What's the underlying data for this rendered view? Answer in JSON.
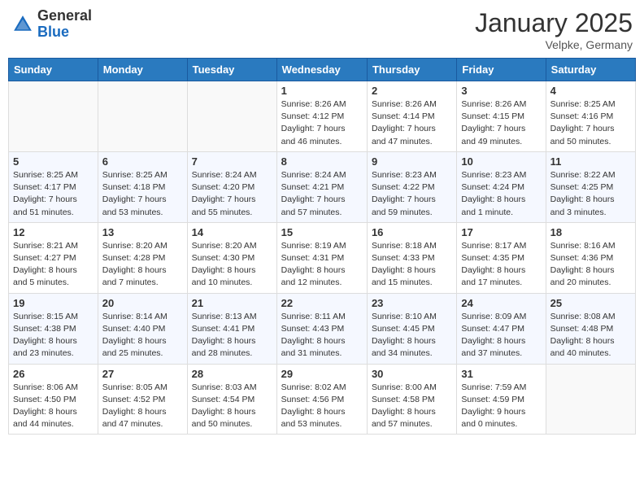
{
  "header": {
    "logo_general": "General",
    "logo_blue": "Blue",
    "month_title": "January 2025",
    "location": "Velpke, Germany"
  },
  "weekdays": [
    "Sunday",
    "Monday",
    "Tuesday",
    "Wednesday",
    "Thursday",
    "Friday",
    "Saturday"
  ],
  "weeks": [
    [
      {
        "day": "",
        "info": ""
      },
      {
        "day": "",
        "info": ""
      },
      {
        "day": "",
        "info": ""
      },
      {
        "day": "1",
        "info": "Sunrise: 8:26 AM\nSunset: 4:12 PM\nDaylight: 7 hours\nand 46 minutes."
      },
      {
        "day": "2",
        "info": "Sunrise: 8:26 AM\nSunset: 4:14 PM\nDaylight: 7 hours\nand 47 minutes."
      },
      {
        "day": "3",
        "info": "Sunrise: 8:26 AM\nSunset: 4:15 PM\nDaylight: 7 hours\nand 49 minutes."
      },
      {
        "day": "4",
        "info": "Sunrise: 8:25 AM\nSunset: 4:16 PM\nDaylight: 7 hours\nand 50 minutes."
      }
    ],
    [
      {
        "day": "5",
        "info": "Sunrise: 8:25 AM\nSunset: 4:17 PM\nDaylight: 7 hours\nand 51 minutes."
      },
      {
        "day": "6",
        "info": "Sunrise: 8:25 AM\nSunset: 4:18 PM\nDaylight: 7 hours\nand 53 minutes."
      },
      {
        "day": "7",
        "info": "Sunrise: 8:24 AM\nSunset: 4:20 PM\nDaylight: 7 hours\nand 55 minutes."
      },
      {
        "day": "8",
        "info": "Sunrise: 8:24 AM\nSunset: 4:21 PM\nDaylight: 7 hours\nand 57 minutes."
      },
      {
        "day": "9",
        "info": "Sunrise: 8:23 AM\nSunset: 4:22 PM\nDaylight: 7 hours\nand 59 minutes."
      },
      {
        "day": "10",
        "info": "Sunrise: 8:23 AM\nSunset: 4:24 PM\nDaylight: 8 hours\nand 1 minute."
      },
      {
        "day": "11",
        "info": "Sunrise: 8:22 AM\nSunset: 4:25 PM\nDaylight: 8 hours\nand 3 minutes."
      }
    ],
    [
      {
        "day": "12",
        "info": "Sunrise: 8:21 AM\nSunset: 4:27 PM\nDaylight: 8 hours\nand 5 minutes."
      },
      {
        "day": "13",
        "info": "Sunrise: 8:20 AM\nSunset: 4:28 PM\nDaylight: 8 hours\nand 7 minutes."
      },
      {
        "day": "14",
        "info": "Sunrise: 8:20 AM\nSunset: 4:30 PM\nDaylight: 8 hours\nand 10 minutes."
      },
      {
        "day": "15",
        "info": "Sunrise: 8:19 AM\nSunset: 4:31 PM\nDaylight: 8 hours\nand 12 minutes."
      },
      {
        "day": "16",
        "info": "Sunrise: 8:18 AM\nSunset: 4:33 PM\nDaylight: 8 hours\nand 15 minutes."
      },
      {
        "day": "17",
        "info": "Sunrise: 8:17 AM\nSunset: 4:35 PM\nDaylight: 8 hours\nand 17 minutes."
      },
      {
        "day": "18",
        "info": "Sunrise: 8:16 AM\nSunset: 4:36 PM\nDaylight: 8 hours\nand 20 minutes."
      }
    ],
    [
      {
        "day": "19",
        "info": "Sunrise: 8:15 AM\nSunset: 4:38 PM\nDaylight: 8 hours\nand 23 minutes."
      },
      {
        "day": "20",
        "info": "Sunrise: 8:14 AM\nSunset: 4:40 PM\nDaylight: 8 hours\nand 25 minutes."
      },
      {
        "day": "21",
        "info": "Sunrise: 8:13 AM\nSunset: 4:41 PM\nDaylight: 8 hours\nand 28 minutes."
      },
      {
        "day": "22",
        "info": "Sunrise: 8:11 AM\nSunset: 4:43 PM\nDaylight: 8 hours\nand 31 minutes."
      },
      {
        "day": "23",
        "info": "Sunrise: 8:10 AM\nSunset: 4:45 PM\nDaylight: 8 hours\nand 34 minutes."
      },
      {
        "day": "24",
        "info": "Sunrise: 8:09 AM\nSunset: 4:47 PM\nDaylight: 8 hours\nand 37 minutes."
      },
      {
        "day": "25",
        "info": "Sunrise: 8:08 AM\nSunset: 4:48 PM\nDaylight: 8 hours\nand 40 minutes."
      }
    ],
    [
      {
        "day": "26",
        "info": "Sunrise: 8:06 AM\nSunset: 4:50 PM\nDaylight: 8 hours\nand 44 minutes."
      },
      {
        "day": "27",
        "info": "Sunrise: 8:05 AM\nSunset: 4:52 PM\nDaylight: 8 hours\nand 47 minutes."
      },
      {
        "day": "28",
        "info": "Sunrise: 8:03 AM\nSunset: 4:54 PM\nDaylight: 8 hours\nand 50 minutes."
      },
      {
        "day": "29",
        "info": "Sunrise: 8:02 AM\nSunset: 4:56 PM\nDaylight: 8 hours\nand 53 minutes."
      },
      {
        "day": "30",
        "info": "Sunrise: 8:00 AM\nSunset: 4:58 PM\nDaylight: 8 hours\nand 57 minutes."
      },
      {
        "day": "31",
        "info": "Sunrise: 7:59 AM\nSunset: 4:59 PM\nDaylight: 9 hours\nand 0 minutes."
      },
      {
        "day": "",
        "info": ""
      }
    ]
  ]
}
